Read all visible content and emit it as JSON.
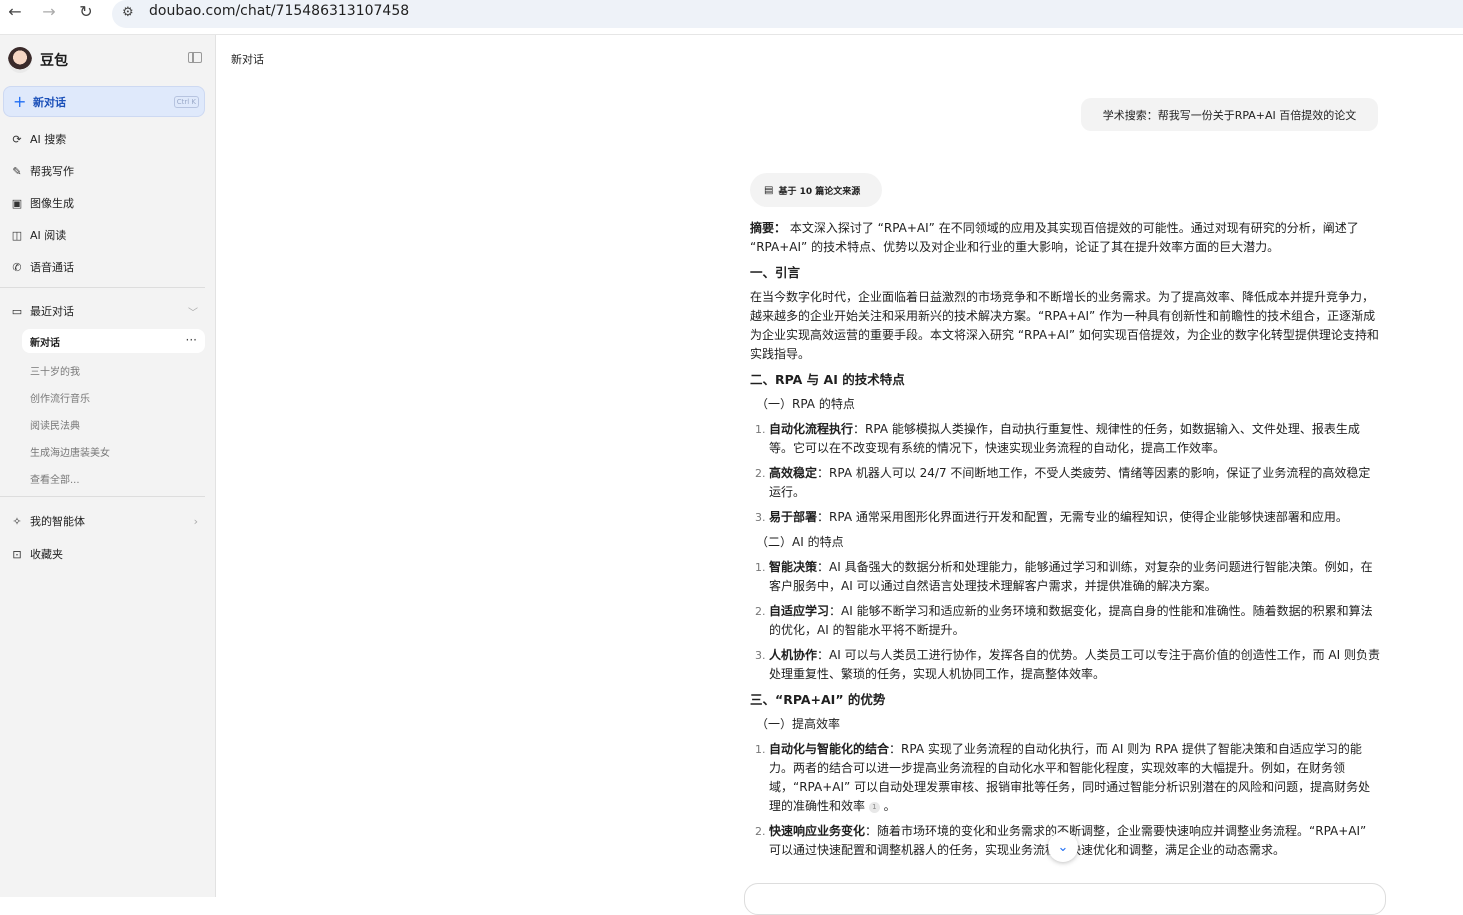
{
  "browser": {
    "url": "doubao.com/chat/715486313107458"
  },
  "sidebar": {
    "brand": "豆包",
    "new_chat": "新对话",
    "new_chat_shortcut": "Ctrl K",
    "menu": [
      "AI 搜索",
      "帮我写作",
      "图像生成",
      "AI 阅读",
      "语音通话"
    ],
    "recent_title": "最近对话",
    "active_chat": "新对话",
    "history": [
      "三十岁的我",
      "创作流行音乐",
      "阅读民法典",
      "生成海边唐装美女",
      "查看全部..."
    ],
    "agents": "我的智能体",
    "favorites": "收藏夹"
  },
  "main": {
    "title": "新对话",
    "question": "学术搜索：帮我写一份关于RPA+AI 百倍提效的论文",
    "sources": "基于 10 篇论文来源",
    "abstract_label": "摘要：",
    "abstract": " 本文深入探讨了 “RPA+AI” 在不同领域的应用及其实现百倍提效的可能性。通过对现有研究的分析，阐述了 “RPA+AI” 的技术特点、优势以及对企业和行业的重大影响，论证了其在提升效率方面的巨大潜力。",
    "h1": "一、引言",
    "intro": "在当今数字化时代，企业面临着日益激烈的市场竞争和不断增长的业务需求。为了提高效率、降低成本并提升竞争力，越来越多的企业开始关注和采用新兴的技术解决方案。“RPA+AI” 作为一种具有创新性和前瞻性的技术组合，正逐渐成为企业实现高效运营的重要手段。本文将深入研究 “RPA+AI” 如何实现百倍提效，为企业的数字化转型提供理论支持和实践指导。",
    "h2": "二、RPA 与 AI 的技术特点",
    "sub1": "（一）RPA 的特点",
    "rpa": [
      {
        "b": "自动化流程执行",
        "t": "：RPA 能够模拟人类操作，自动执行重复性、规律性的任务，如数据输入、文件处理、报表生成等。它可以在不改变现有系统的情况下，快速实现业务流程的自动化，提高工作效率。"
      },
      {
        "b": "高效稳定",
        "t": "：RPA 机器人可以 24/7 不间断地工作，不受人类疲劳、情绪等因素的影响，保证了业务流程的高效稳定运行。"
      },
      {
        "b": "易于部署",
        "t": "：RPA 通常采用图形化界面进行开发和配置，无需专业的编程知识，使得企业能够快速部署和应用。"
      }
    ],
    "sub2": "（二）AI 的特点",
    "ai": [
      {
        "b": "智能决策",
        "t": "：AI 具备强大的数据分析和处理能力，能够通过学习和训练，对复杂的业务问题进行智能决策。例如，在客户服务中，AI 可以通过自然语言处理技术理解客户需求，并提供准确的解决方案。"
      },
      {
        "b": "自适应学习",
        "t": "：AI 能够不断学习和适应新的业务环境和数据变化，提高自身的性能和准确性。随着数据的积累和算法的优化，AI 的智能水平将不断提升。"
      },
      {
        "b": "人机协作",
        "t": "：AI 可以与人类员工进行协作，发挥各自的优势。人类员工可以专注于高价值的创造性工作，而 AI 则负责处理重复性、繁琐的任务，实现人机协同工作，提高整体效率。"
      }
    ],
    "h3": "三、“RPA+AI” 的优势",
    "sub3": "（一）提高效率",
    "adv": [
      {
        "b": "自动化与智能化的结合",
        "t": "：RPA 实现了业务流程的自动化执行，而 AI 则为 RPA 提供了智能决策和自适应学习的能力。两者的结合可以进一步提高业务流程的自动化水平和智能化程度，实现效率的大幅提升。例如，在财务领域，“RPA+AI” 可以自动处理发票审核、报销审批等任务，同时通过智能分析识别潜在的风险和问题，提高财务处理的准确性和效率",
        "cite": "1",
        "end": " 。"
      },
      {
        "b": "快速响应业务变化",
        "t": "：随着市场环境的变化和业务需求的不断调整，企业需要快速响应并调整业务流程。“RPA+AI” 可以通过快速配置和调整机器人的任务，实现业务流程的快速优化和调整，满足企业的动态需求。"
      }
    ]
  }
}
